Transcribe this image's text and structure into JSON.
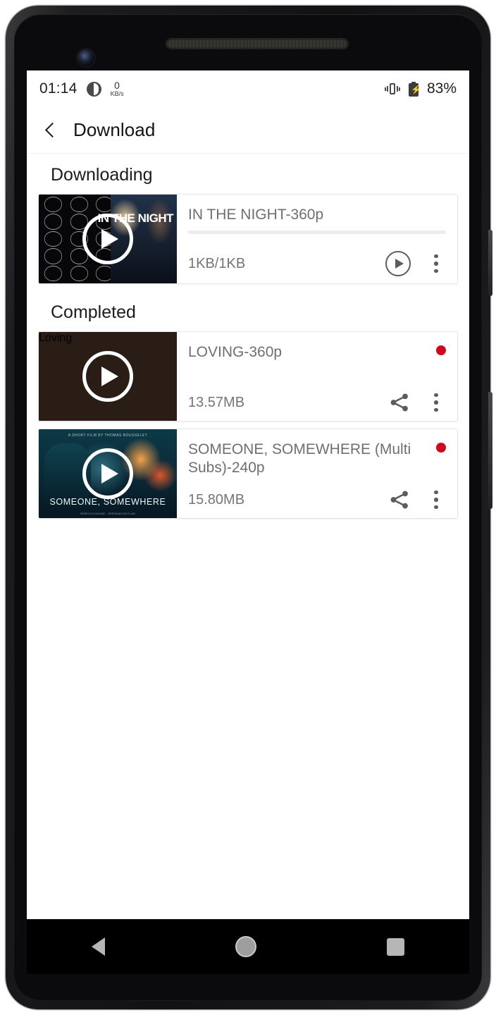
{
  "status_bar": {
    "clock": "01:14",
    "data_saver_icon": "data-saver-icon",
    "network_speed_value": "0",
    "network_speed_unit": "KB/s",
    "vibrate_icon": "vibrate-icon",
    "battery_icon": "battery-charging-icon",
    "battery_percent": "83%"
  },
  "app_bar": {
    "back_icon": "back-chevron-icon",
    "title": "Download"
  },
  "sections": [
    {
      "id": "downloading",
      "header": "Downloading"
    },
    {
      "id": "completed",
      "header": "Completed"
    }
  ],
  "downloading": [
    {
      "title": "IN THE NIGHT-360p",
      "size": "1KB/1KB",
      "progress_percent": 0,
      "thumbnail_art": "in-the-night-poster",
      "thumbnail_title": "IN THE NIGHT",
      "play_icon": "play-circle-icon",
      "resume_icon": "resume-play-icon",
      "more_icon": "more-vertical-icon"
    }
  ],
  "completed": [
    {
      "title": "LOVING-360p",
      "size": "13.57MB",
      "badge_color": "#cf0a1e",
      "thumbnail_art": "loving-mosaic-poster",
      "thumbnail_title": "Loving",
      "play_icon": "play-circle-icon",
      "share_icon": "share-icon",
      "more_icon": "more-vertical-icon"
    },
    {
      "title": "SOMEONE, SOMEWHERE (Multi Subs)-240p",
      "size": "15.80MB",
      "badge_color": "#cf0a1e",
      "thumbnail_art": "someone-somewhere-poster",
      "thumbnail_title": "SOMEONE, SOMEWHERE",
      "thumbnail_toptext": "A SHORT FILM BY THOMAS BOUSSELET",
      "thumbnail_credits": "REBECCA DIANNE  ·  JEREMIAH MCCLAIN",
      "play_icon": "play-circle-icon",
      "share_icon": "share-icon",
      "more_icon": "more-vertical-icon"
    }
  ],
  "nav_bar": {
    "back_label": "back-triangle-icon",
    "home_label": "home-circle-icon",
    "recents_label": "recents-square-icon"
  }
}
